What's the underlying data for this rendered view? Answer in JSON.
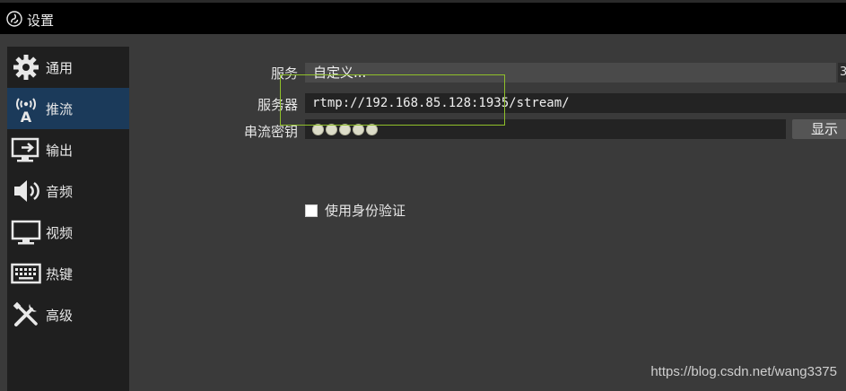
{
  "window": {
    "title": "设置"
  },
  "sidebar": {
    "items": [
      {
        "label": "通用",
        "icon": "gear-icon"
      },
      {
        "label": "推流",
        "icon": "broadcast-antenna-icon"
      },
      {
        "label": "输出",
        "icon": "output-monitor-icon"
      },
      {
        "label": "音频",
        "icon": "speaker-icon"
      },
      {
        "label": "视频",
        "icon": "monitor-icon"
      },
      {
        "label": "热键",
        "icon": "keyboard-icon"
      },
      {
        "label": "高级",
        "icon": "tools-icon"
      }
    ],
    "selected": "推流"
  },
  "form": {
    "service_label": "服务",
    "service_value": "自定义...",
    "service_cut": "3",
    "server_label": "服务器",
    "server_value": "rtmp://192.168.85.128:1935/stream/",
    "stream_key_label": "串流密钥",
    "stream_key_dots": 5,
    "show_button": "显示",
    "use_auth_label": "使用身份验证",
    "use_auth_checked": false
  },
  "watermark": "https://blog.csdn.net/wang3375",
  "colors": {
    "titlebar": "#000000",
    "background": "#3a3a3a",
    "sidebar_list": "#1f1f1f",
    "selected_item": "#1b3a5a",
    "highlight_box": "#8fbf2a"
  }
}
